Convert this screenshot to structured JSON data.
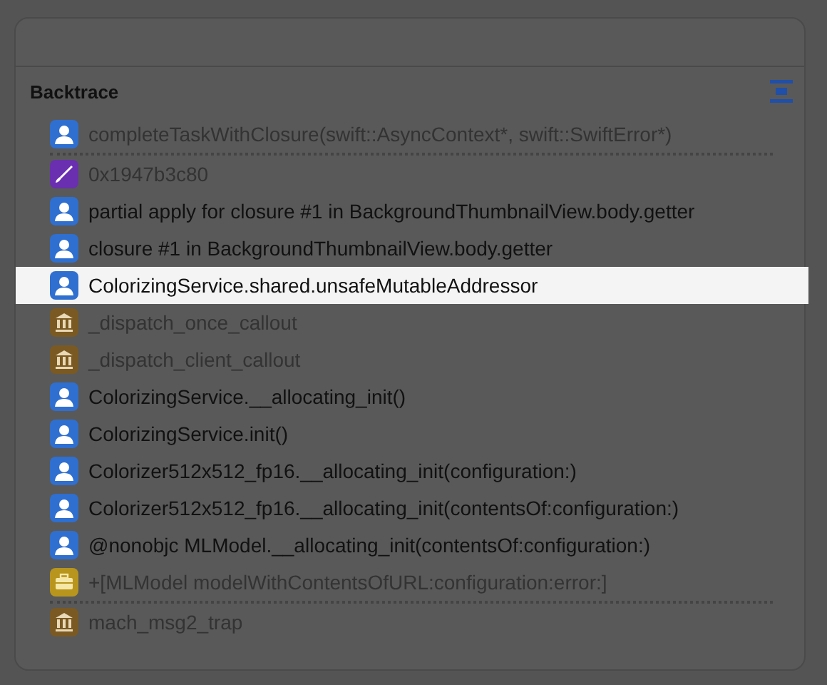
{
  "panel": {
    "title": "Backtrace",
    "frames": [
      {
        "kind": "user",
        "label": "completeTaskWithClosure(swift::AsyncContext*, swift::SwiftError*)",
        "dimmed": true,
        "selected": false,
        "separator_after": true
      },
      {
        "kind": "unknown",
        "label": "0x1947b3c80",
        "dimmed": true,
        "selected": false,
        "separator_after": false
      },
      {
        "kind": "user",
        "label": "partial apply for closure #1 in BackgroundThumbnailView.body.getter",
        "dimmed": false,
        "selected": false,
        "separator_after": false
      },
      {
        "kind": "user",
        "label": "closure #1 in BackgroundThumbnailView.body.getter",
        "dimmed": false,
        "selected": false,
        "separator_after": false
      },
      {
        "kind": "user",
        "label": "ColorizingService.shared.unsafeMutableAddressor",
        "dimmed": false,
        "selected": true,
        "separator_after": false
      },
      {
        "kind": "library",
        "label": "_dispatch_once_callout",
        "dimmed": true,
        "selected": false,
        "separator_after": false
      },
      {
        "kind": "library",
        "label": "_dispatch_client_callout",
        "dimmed": true,
        "selected": false,
        "separator_after": false
      },
      {
        "kind": "user",
        "label": "ColorizingService.__allocating_init()",
        "dimmed": false,
        "selected": false,
        "separator_after": false
      },
      {
        "kind": "user",
        "label": "ColorizingService.init()",
        "dimmed": false,
        "selected": false,
        "separator_after": false
      },
      {
        "kind": "user",
        "label": "Colorizer512x512_fp16.__allocating_init(configuration:)",
        "dimmed": false,
        "selected": false,
        "separator_after": false
      },
      {
        "kind": "user",
        "label": "Colorizer512x512_fp16.__allocating_init(contentsOf:configuration:)",
        "dimmed": false,
        "selected": false,
        "separator_after": false
      },
      {
        "kind": "user",
        "label": "@nonobjc MLModel.__allocating_init(contentsOf:configuration:)",
        "dimmed": false,
        "selected": false,
        "separator_after": false
      },
      {
        "kind": "framework",
        "label": "+[MLModel modelWithContentsOfURL:configuration:error:]",
        "dimmed": true,
        "selected": false,
        "separator_after": true
      },
      {
        "kind": "library",
        "label": "mach_msg2_trap",
        "dimmed": true,
        "selected": false,
        "separator_after": false
      }
    ]
  }
}
